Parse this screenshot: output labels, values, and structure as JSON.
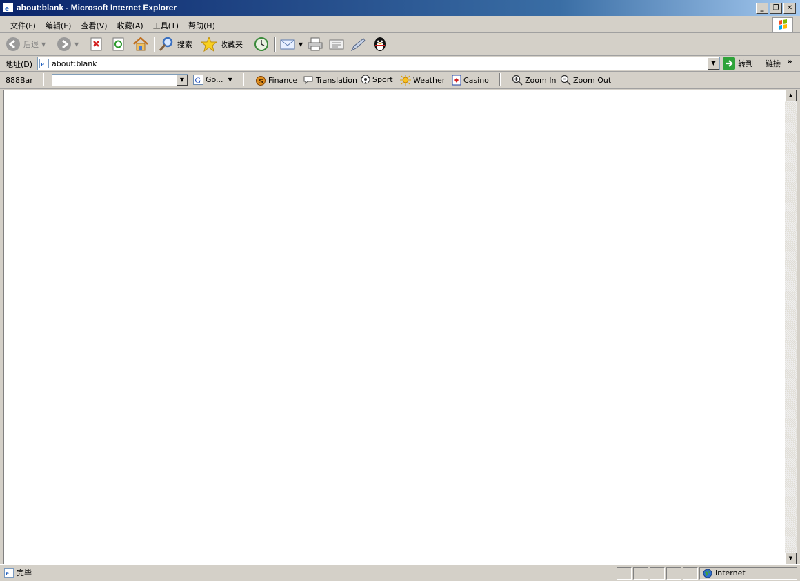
{
  "window": {
    "title": "about:blank - Microsoft Internet Explorer",
    "minimize": "_",
    "restore": "❐",
    "close": "✕"
  },
  "menu": {
    "items": [
      "文件(F)",
      "编辑(E)",
      "查看(V)",
      "收藏(A)",
      "工具(T)",
      "帮助(H)"
    ]
  },
  "toolbar": {
    "back_label": "后退",
    "search_label": "搜索",
    "favorites_label": "收藏夹"
  },
  "address": {
    "label": "地址(D)",
    "value": "about:blank",
    "go_label": "转到",
    "links_label": "链接",
    "chevron": "»"
  },
  "bar888": {
    "label": "888Bar",
    "search_button": "Go...",
    "items": [
      "Finance",
      "Translation",
      "Sport",
      "Weather",
      "Casino",
      "Zoom In",
      "Zoom Out"
    ]
  },
  "status": {
    "text": "完毕",
    "zone": "Internet"
  },
  "colors": {
    "titlebar_start": "#0a246a",
    "chrome": "#d4d0c8",
    "content": "#ffffff"
  }
}
